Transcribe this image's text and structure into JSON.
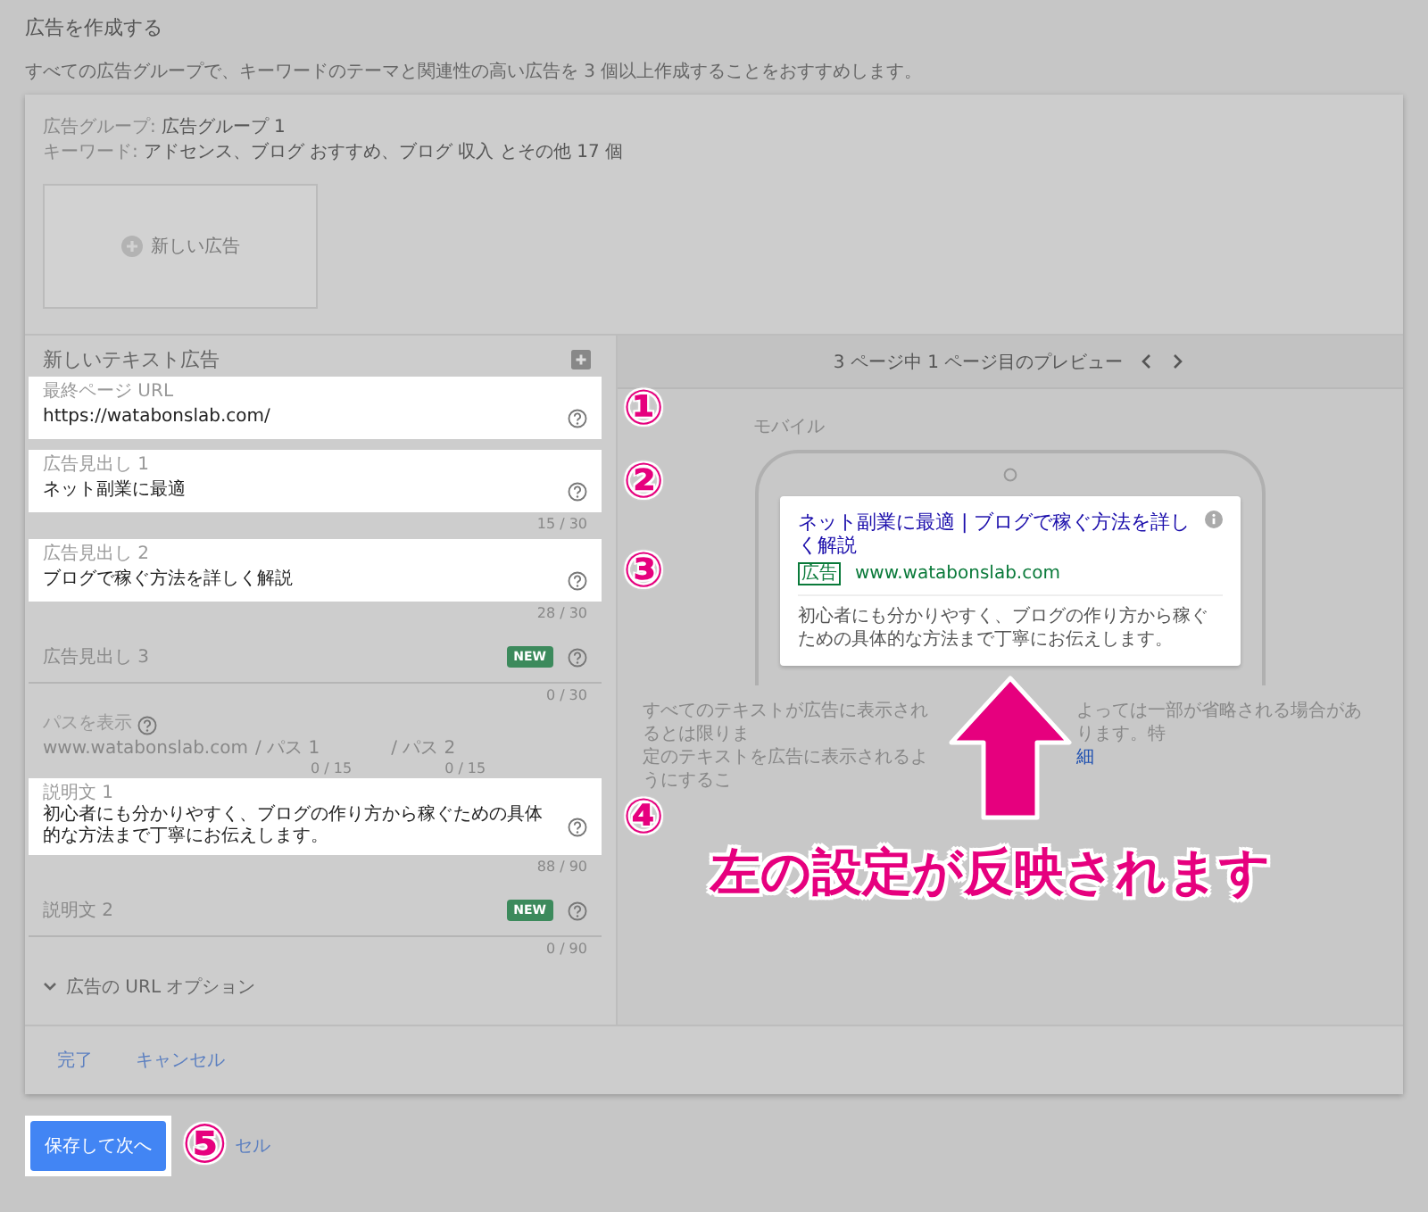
{
  "page": {
    "title": "広告を作成する",
    "subtitle": "すべての広告グループで、キーワードのテーマと関連性の高い広告を 3 個以上作成することをおすすめします。"
  },
  "ad_group": {
    "group_label": "広告グループ:",
    "group_name": "広告グループ 1",
    "keyword_label": "キーワード:",
    "keywords": "アドセンス、ブログ おすすめ、ブログ 収入 とその他 17 個",
    "new_ad_button": "新しい広告"
  },
  "editor": {
    "title": "新しいテキスト広告",
    "fields": [
      {
        "kind": "input",
        "label": "最終ページ URL",
        "value": "https://watabonslab.com/",
        "highlighted": true,
        "marker": "①"
      },
      {
        "kind": "input",
        "label": "広告見出し 1",
        "value": "ネット副業に最適",
        "highlighted": true,
        "marker": "②",
        "counter": "15 / 30"
      },
      {
        "kind": "input",
        "label": "広告見出し 2",
        "value": "ブログで稼ぐ方法を詳しく解説",
        "highlighted": true,
        "marker": "③",
        "counter": "28 / 30"
      },
      {
        "kind": "input",
        "label": "広告見出し 3",
        "badge": "NEW",
        "highlighted": false,
        "counter": "0 / 30"
      },
      {
        "kind": "path",
        "label": "パスを表示",
        "domain": "www.watabonslab.com",
        "path_1": "/ パス 1",
        "path_2": "/ パス 2",
        "counters": [
          "0 / 15",
          "0 / 15"
        ]
      },
      {
        "kind": "input",
        "label": "説明文 1",
        "value": "初心者にも分かりやすく、ブログの作り方から稼ぐための具体的な方法まで丁寧にお伝えします。",
        "highlighted": true,
        "marker": "④",
        "counter": "88 / 90"
      },
      {
        "kind": "input",
        "label": "説明文 2",
        "badge": "NEW",
        "highlighted": false,
        "counter": "0 / 90"
      }
    ],
    "url_options": "広告の URL オプション"
  },
  "preview": {
    "pager": "3 ページ中 1 ページ目のプレビュー",
    "device": "モバイル",
    "ad": {
      "headline": "ネット副業に最適 | ブログで稼ぐ方法を詳しく解説",
      "ad_label": "広告",
      "url": "www.watabonslab.com",
      "description": "初心者にも分かりやすく、ブログの作り方から稼ぐための具体的な方法まで丁寧にお伝えします。"
    },
    "disclaimer": [
      "すべてのテキストが広告に表示されるとは限りま",
      "よっては一部が省略される場合があります。特",
      "定のテキストを広告に表示されるようにするこ"
    ],
    "disclaimer_link": "細"
  },
  "card_actions": [
    "完了",
    "キャンセル"
  ],
  "page_actions": {
    "primary": "保存して次へ",
    "secondary": "セル",
    "marker": "⑤"
  },
  "callout": "左の設定が反映されます"
}
